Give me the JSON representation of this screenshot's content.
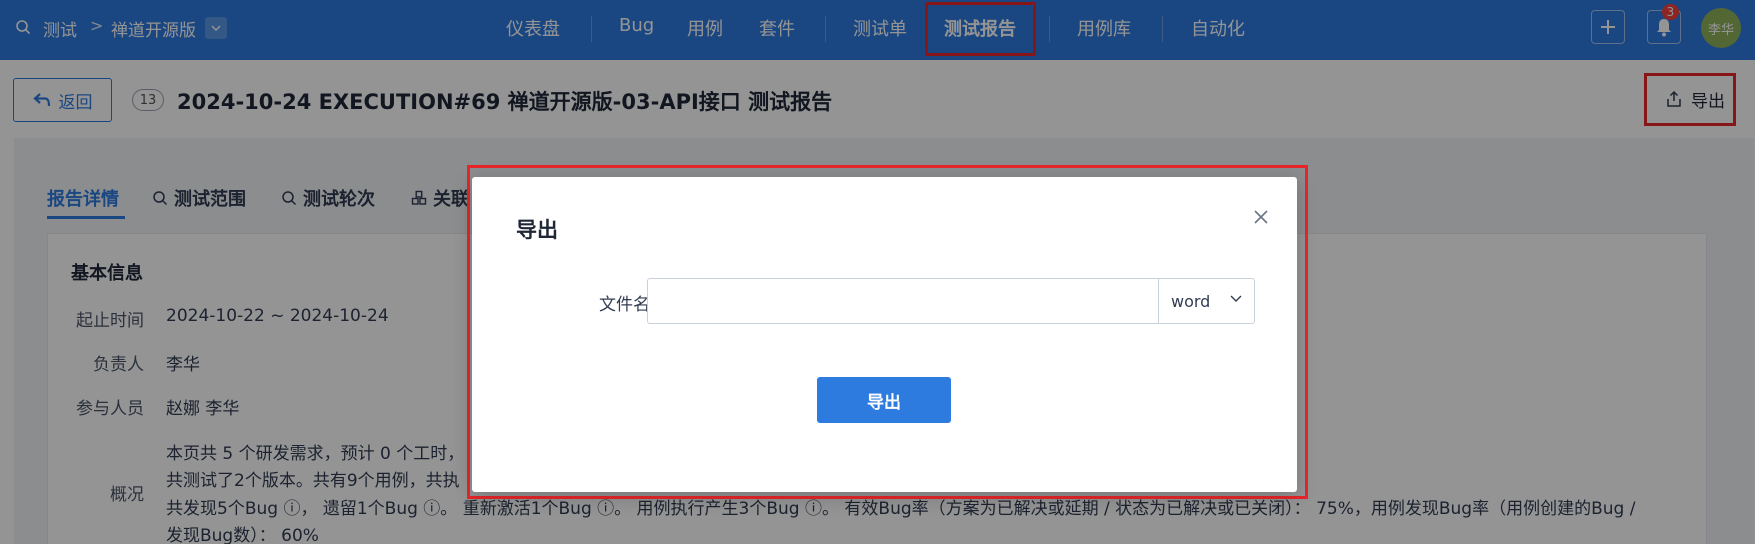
{
  "topbar": {
    "product": "测试",
    "separator": ">",
    "branch": "禅道开源版",
    "nav": [
      {
        "label": "仪表盘"
      },
      {
        "label": "Bug"
      },
      {
        "label": "用例"
      },
      {
        "label": "套件"
      },
      {
        "label": "测试单"
      },
      {
        "label": "测试报告",
        "active": true
      },
      {
        "label": "用例库"
      },
      {
        "label": "自动化"
      }
    ],
    "notification_count": "3",
    "avatar_text": "李华"
  },
  "header": {
    "back_label": "返回",
    "count": "13",
    "title": "2024-10-24 EXECUTION#69 禅道开源版-03-API接口 测试报告",
    "export_label": "导出"
  },
  "tabs": [
    {
      "label": "报告详情",
      "active": true
    },
    {
      "label": "测试范围"
    },
    {
      "label": "测试轮次"
    },
    {
      "label": "关联"
    }
  ],
  "basic_info": {
    "title": "基本信息",
    "fields": [
      {
        "label": "起止时间",
        "value": "2024-10-22 ~ 2024-10-24"
      },
      {
        "label": "负责人",
        "value": "李华"
      },
      {
        "label": "参与人员",
        "value": "赵娜 李华"
      }
    ],
    "summary_label": "概况",
    "summary_lines": [
      "本页共 5 个研发需求，预计 0 个工时，",
      "共测试了2个版本。共有9个用例，共执",
      "共发现5个Bug ⓘ， 遗留1个Bug ⓘ。 重新激活1个Bug ⓘ。 用例执行产生3个Bug ⓘ。 有效Bug率（方案为已解决或延期 / 状态为已解决或已关闭）： 75%，用例发现Bug率（用例创建的Bug /",
      "发现Bug数）： 60%"
    ]
  },
  "modal": {
    "title": "导出",
    "filename_label": "文件名：",
    "filename_value": "",
    "format_value": "word",
    "submit_label": "导出"
  },
  "colors": {
    "primary": "#2e7be0",
    "highlight": "#e8262a",
    "badge": "#f0423e"
  }
}
